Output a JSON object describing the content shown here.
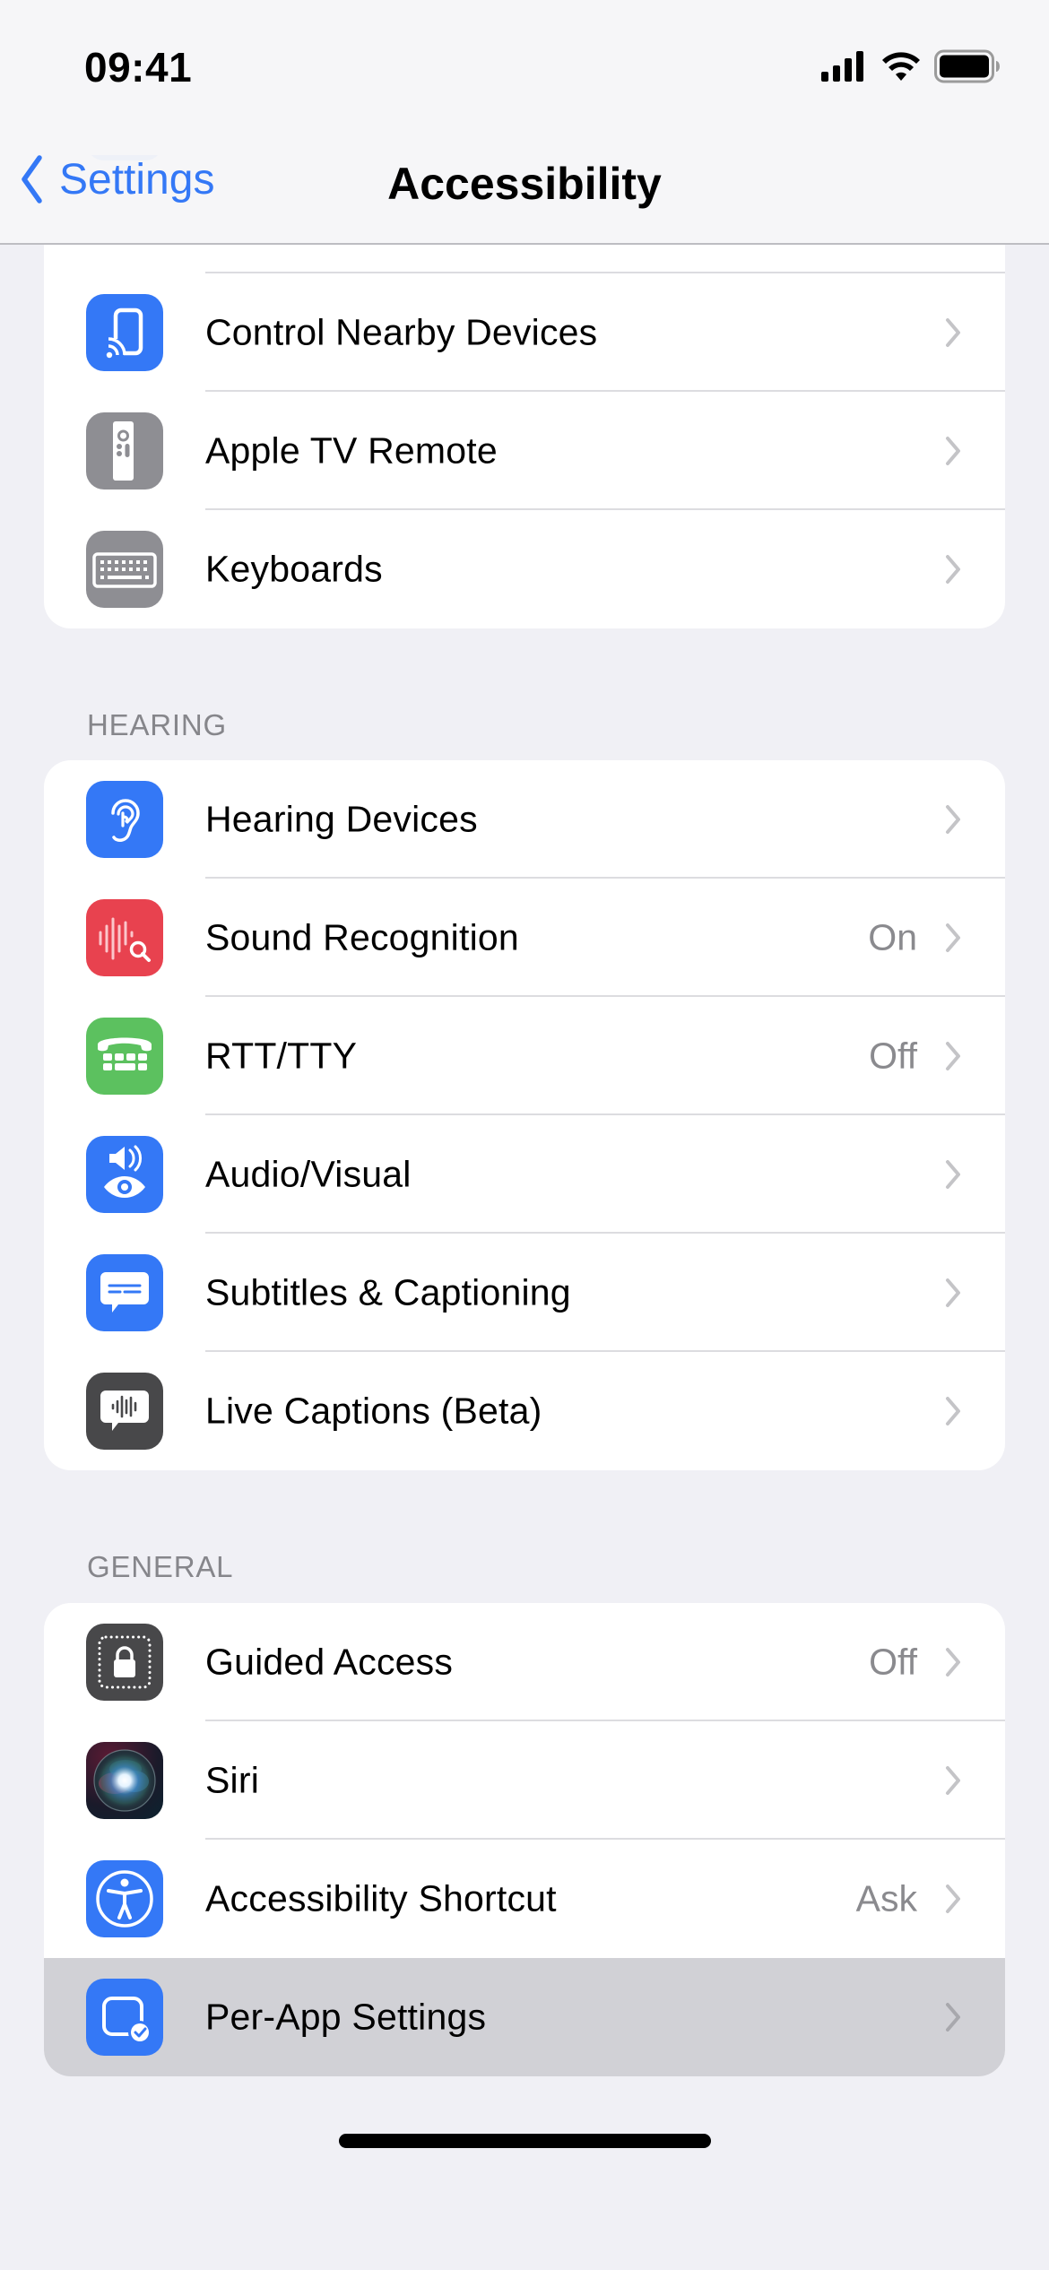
{
  "status_bar": {
    "time": "09:41",
    "icons": [
      "cellular-signal-icon",
      "wifi-icon",
      "battery-icon"
    ]
  },
  "nav": {
    "back_label": "Settings",
    "title": "Accessibility"
  },
  "sections": {
    "top": {
      "items": [
        {
          "label": "",
          "icon": "partial-blue-icon",
          "value": ""
        },
        {
          "label": "Control Nearby Devices",
          "icon": "control-nearby-devices-icon",
          "value": ""
        },
        {
          "label": "Apple TV Remote",
          "icon": "apple-tv-remote-icon",
          "value": ""
        },
        {
          "label": "Keyboards",
          "icon": "keyboard-icon",
          "value": ""
        }
      ]
    },
    "hearing": {
      "header": "HEARING",
      "items": [
        {
          "label": "Hearing Devices",
          "icon": "ear-icon",
          "value": ""
        },
        {
          "label": "Sound Recognition",
          "icon": "sound-recognition-icon",
          "value": "On"
        },
        {
          "label": "RTT/TTY",
          "icon": "tty-phone-icon",
          "value": "Off"
        },
        {
          "label": "Audio/Visual",
          "icon": "speaker-eye-icon",
          "value": ""
        },
        {
          "label": "Subtitles & Captioning",
          "icon": "caption-bubble-icon",
          "value": ""
        },
        {
          "label": "Live Captions (Beta)",
          "icon": "live-captions-icon",
          "value": ""
        }
      ]
    },
    "general": {
      "header": "GENERAL",
      "items": [
        {
          "label": "Guided Access",
          "icon": "lock-dotted-frame-icon",
          "value": "Off"
        },
        {
          "label": "Siri",
          "icon": "siri-icon",
          "value": ""
        },
        {
          "label": "Accessibility Shortcut",
          "icon": "accessibility-person-icon",
          "value": "Ask"
        },
        {
          "label": "Per-App Settings",
          "icon": "per-app-settings-icon",
          "value": "",
          "pressed": true
        }
      ]
    }
  },
  "colors": {
    "accent": "#3478f6",
    "background": "#f0f0f5",
    "blue_icon": "#3478f6",
    "gray_icon": "#8e8e93",
    "red_icon": "#e8424f",
    "green_icon": "#5cc15f",
    "dark_icon": "#48484a",
    "secondary_text": "#8a8a8e"
  }
}
